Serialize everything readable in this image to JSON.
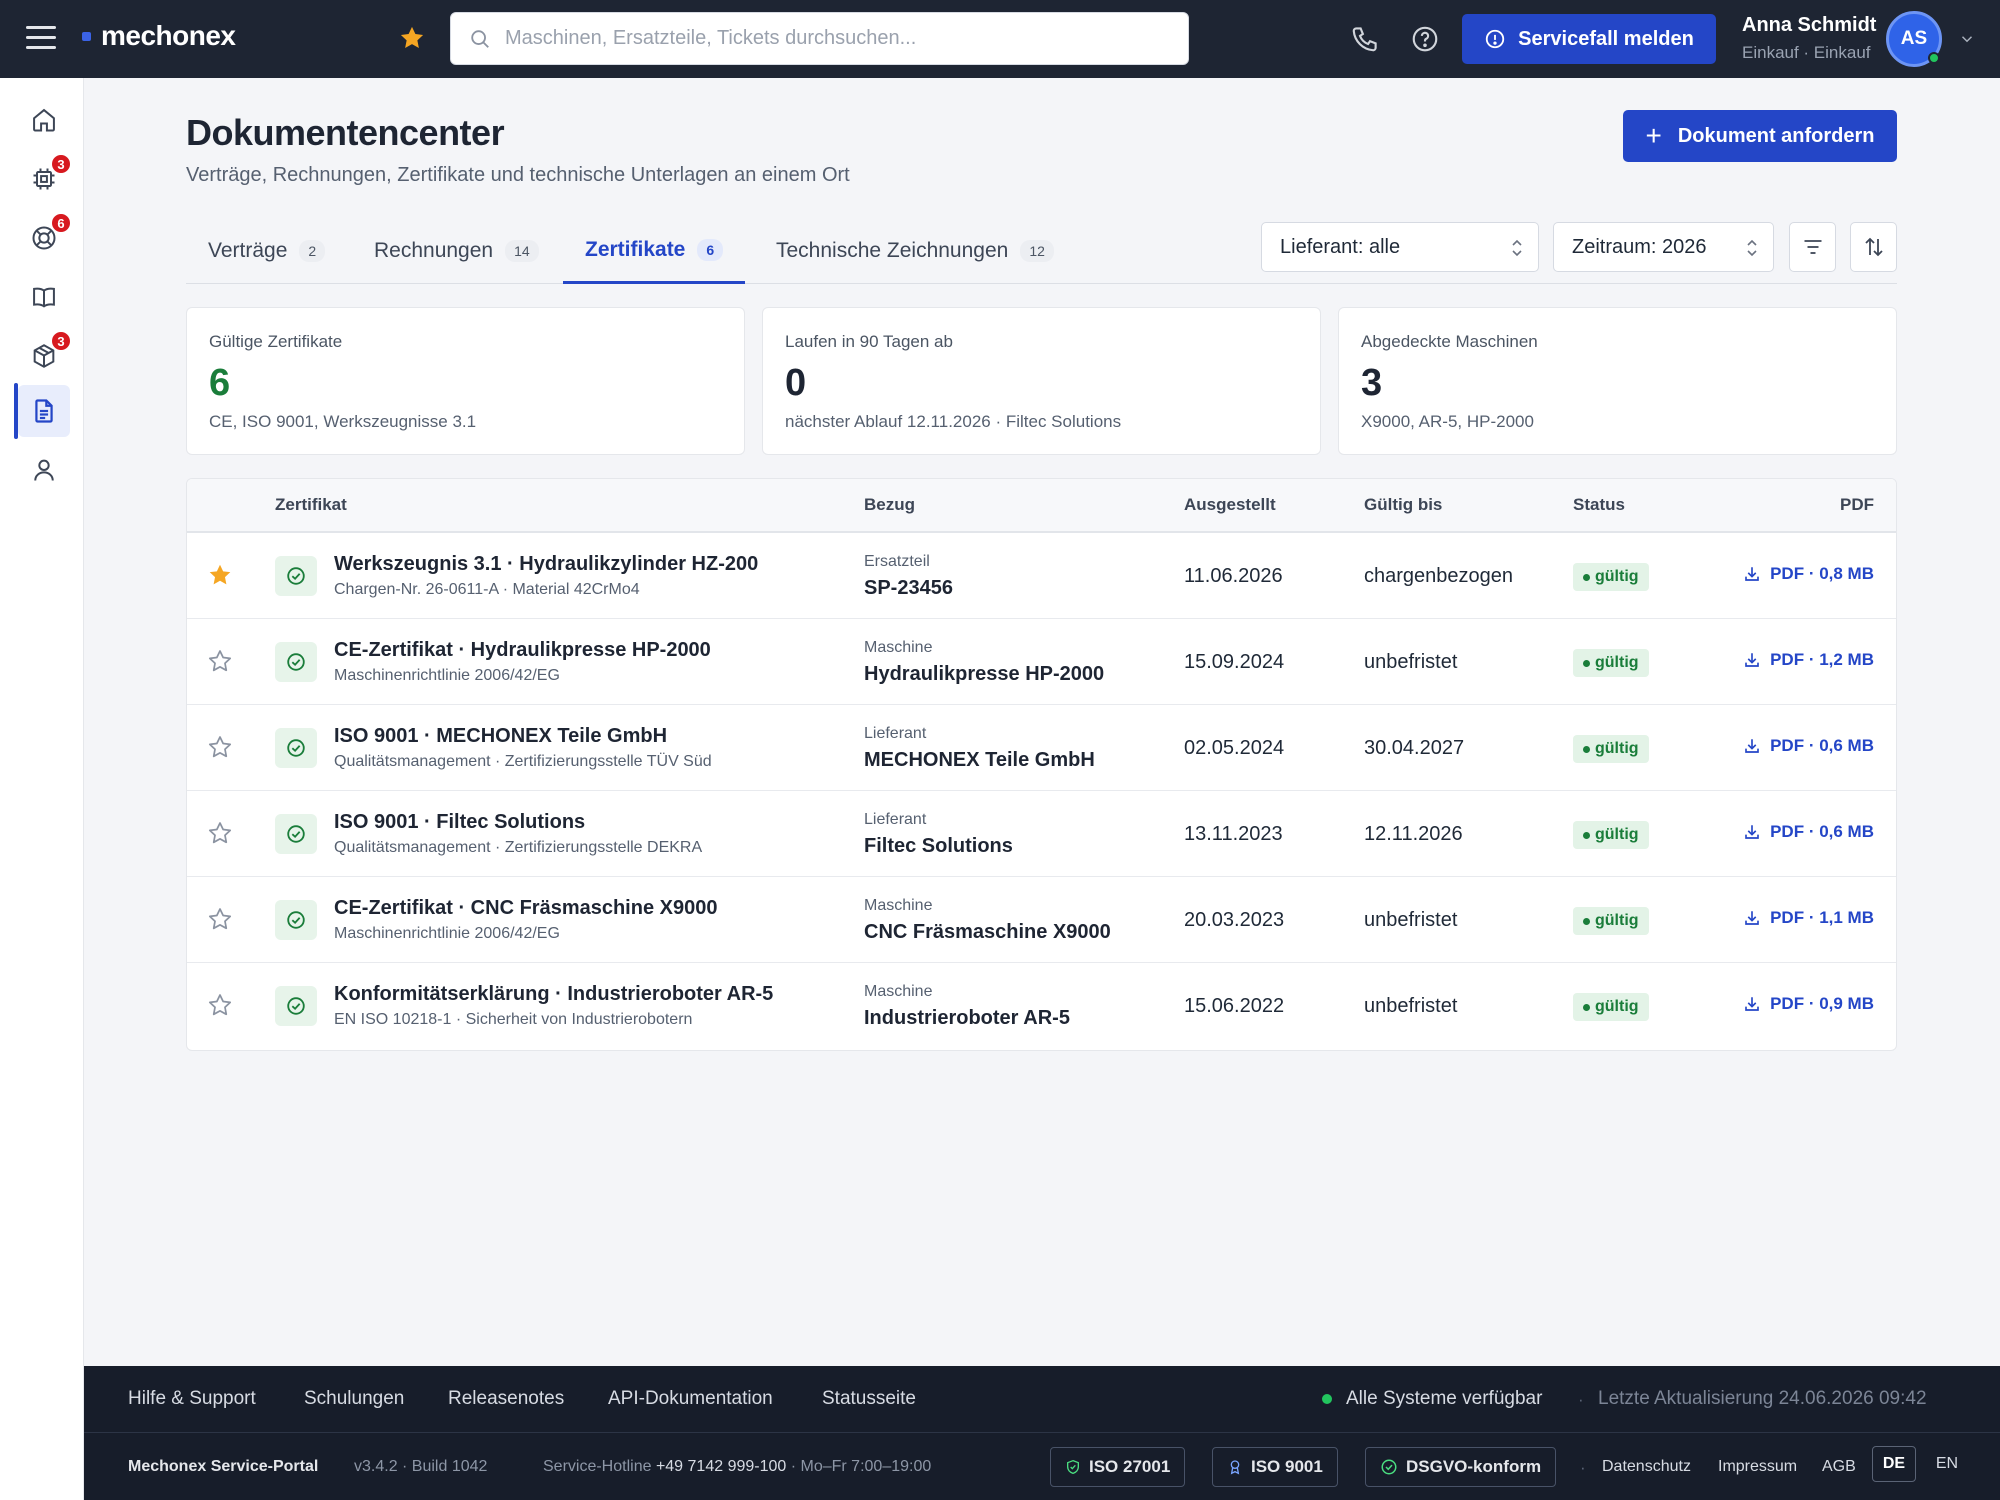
{
  "topbar": {
    "logo_text": "mechonex",
    "search_placeholder": "Maschinen, Ersatzteile, Tickets durchsuchen...",
    "service_button": "Servicefall melden",
    "user_name": "Anna Schmidt",
    "user_role": "Einkauf · Einkauf",
    "avatar_initials": "AS"
  },
  "sidebar": {
    "items": [
      {
        "icon": "home-icon",
        "badge": ""
      },
      {
        "icon": "chip-icon",
        "badge": "3"
      },
      {
        "icon": "lifebuoy-icon",
        "badge": "6"
      },
      {
        "icon": "book-icon",
        "badge": ""
      },
      {
        "icon": "package-icon",
        "badge": "3"
      },
      {
        "icon": "document-icon",
        "badge": "",
        "active": true
      },
      {
        "icon": "user-icon",
        "badge": ""
      }
    ]
  },
  "page": {
    "title": "Dokumentencenter",
    "subtitle": "Verträge, Rechnungen, Zertifikate und technische Unterlagen an einem Ort",
    "request_button": "Dokument anfordern"
  },
  "tabs": [
    {
      "label": "Verträge",
      "count": "2"
    },
    {
      "label": "Rechnungen",
      "count": "14"
    },
    {
      "label": "Zertifikate",
      "count": "6",
      "active": true
    },
    {
      "label": "Technische Zeichnungen",
      "count": "12"
    }
  ],
  "filters": {
    "supplier": "Lieferant: alle",
    "period": "Zeitraum: 2026"
  },
  "stats": [
    {
      "label": "Gültige Zertifikate",
      "value": "6",
      "detail": "CE, ISO 9001, Werkszeugnisse 3.1"
    },
    {
      "label": "Laufen in 90 Tagen ab",
      "value": "0",
      "detail": "nächster Ablauf 12.11.2026 · Filtec Solutions"
    },
    {
      "label": "Abgedeckte Maschinen",
      "value": "3",
      "detail": "X9000, AR-5, HP-2000"
    }
  ],
  "table": {
    "headers": {
      "cert": "Zertifikat",
      "ref": "Bezug",
      "issued": "Ausgestellt",
      "valid": "Gültig bis",
      "status": "Status",
      "pdf": "PDF"
    },
    "rows": [
      {
        "starred": true,
        "name": "Werkszeugnis 3.1 · Hydraulikzylinder HZ-200",
        "sub": "Chargen-Nr. 26-0611-A · Material 42CrMo4",
        "ref_type": "Ersatzteil",
        "ref_name": "SP-23456",
        "issued": "11.06.2026",
        "valid": "chargenbezogen",
        "status": "gültig",
        "pdf": "PDF · 0,8 MB"
      },
      {
        "starred": false,
        "name": "CE-Zertifikat · Hydraulikpresse HP-2000",
        "sub": "Maschinenrichtlinie 2006/42/EG",
        "ref_type": "Maschine",
        "ref_name": "Hydraulikpresse HP-2000",
        "issued": "15.09.2024",
        "valid": "unbefristet",
        "status": "gültig",
        "pdf": "PDF · 1,2 MB"
      },
      {
        "starred": false,
        "name": "ISO 9001 · MECHONEX Teile GmbH",
        "sub": "Qualitätsmanagement · Zertifizierungsstelle TÜV Süd",
        "ref_type": "Lieferant",
        "ref_name": "MECHONEX Teile GmbH",
        "issued": "02.05.2024",
        "valid": "30.04.2027",
        "status": "gültig",
        "pdf": "PDF · 0,6 MB"
      },
      {
        "starred": false,
        "name": "ISO 9001 · Filtec Solutions",
        "sub": "Qualitätsmanagement · Zertifizierungsstelle DEKRA",
        "ref_type": "Lieferant",
        "ref_name": "Filtec Solutions",
        "issued": "13.11.2023",
        "valid": "12.11.2026",
        "status": "gültig",
        "pdf": "PDF · 0,6 MB"
      },
      {
        "starred": false,
        "name": "CE-Zertifikat · CNC Fräsmaschine X9000",
        "sub": "Maschinenrichtlinie 2006/42/EG",
        "ref_type": "Maschine",
        "ref_name": "CNC Fräsmaschine X9000",
        "issued": "20.03.2023",
        "valid": "unbefristet",
        "status": "gültig",
        "pdf": "PDF · 1,1 MB"
      },
      {
        "starred": false,
        "name": "Konformitätserklärung · Industrieroboter AR-5",
        "sub": "EN ISO 10218-1 · Sicherheit von Industrierobotern",
        "ref_type": "Maschine",
        "ref_name": "Industrieroboter AR-5",
        "issued": "15.06.2022",
        "valid": "unbefristet",
        "status": "gültig",
        "pdf": "PDF · 0,9 MB"
      }
    ]
  },
  "footer": {
    "links": [
      "Hilfe & Support",
      "Schulungen",
      "Releasenotes",
      "API-Dokumentation",
      "Statusseite"
    ],
    "system_status": "Alle Systeme verfügbar",
    "last_update": "Letzte Aktualisierung 24.06.2026 09:42",
    "portal_name": "Mechonex Service-Portal",
    "version": "v3.4.2 · Build 1042",
    "hotline_prefix": "Service-Hotline",
    "hotline_number": "+49 7142 999-100",
    "hotline_hours": "· Mo–Fr 7:00–19:00",
    "badges": [
      "ISO 27001",
      "ISO 9001",
      "DSGVO-konform"
    ],
    "legal": [
      "Datenschutz",
      "Impressum",
      "AGB"
    ],
    "languages": [
      "DE",
      "EN"
    ]
  },
  "colors": {
    "topbar": "#1e2533",
    "accent": "#2446c7",
    "valid_green": "#1a7d3a",
    "favorite_star": "#f5a623",
    "badge_red": "#d7191f"
  }
}
